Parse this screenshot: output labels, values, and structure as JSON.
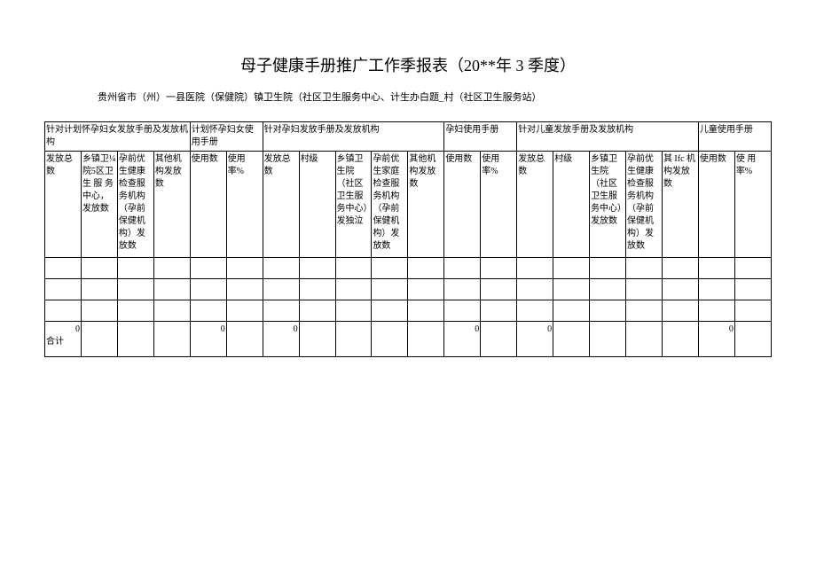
{
  "title": "母子健康手册推广工作季报表（20**年 3 季度）",
  "subtitle": "贵州省市（州）一县医院（保健院）镇卫生院（社区卫生服务中心、计生办白题_村（社区卫生服务站）",
  "headers": {
    "group1": "针对计划怀孕妇女发放手册及发放机构",
    "group2": "计划怀孕妇女使用手册",
    "group3": "针对孕妇发放手册及发放机构",
    "group4": "孕妇使用手册",
    "group5": "针对儿童发放手册及发放机构",
    "group6": "儿童使用手册",
    "col1": "发放总数",
    "col2": "乡镇卫¼院5区卫生 服 务中心，发放数",
    "col3": "孕前优生健康检查服务机构（孕前保健机构）发放数",
    "col4": "其他机构发放数",
    "col5": "使用数",
    "col6": "使用率%",
    "col7": "发放总数",
    "col8": "村级",
    "col9": "乡镇卫生院（社区卫生服务中心）发独泣",
    "col10": "孕前优生家庭检查服务机构（孕前保健机构）发放数",
    "col11": "其他机构发放数",
    "col12": "使用数",
    "col13": "使用率%",
    "col14": "发放总数",
    "col15": "村级",
    "col16": "乡镇卫生院（社区卫生服务中心）发放数",
    "col17": "孕前优生健康检查服务机构（孕前保健机构）发放数",
    "col18": "其 Ifc 机构发放数",
    "col19": "使用数",
    "col20": "使 用 率%"
  },
  "total_label": "合计",
  "totals": {
    "col1": "0",
    "col5": "0",
    "col7": "0",
    "col12": "0",
    "col14": "0",
    "col19": "0"
  }
}
